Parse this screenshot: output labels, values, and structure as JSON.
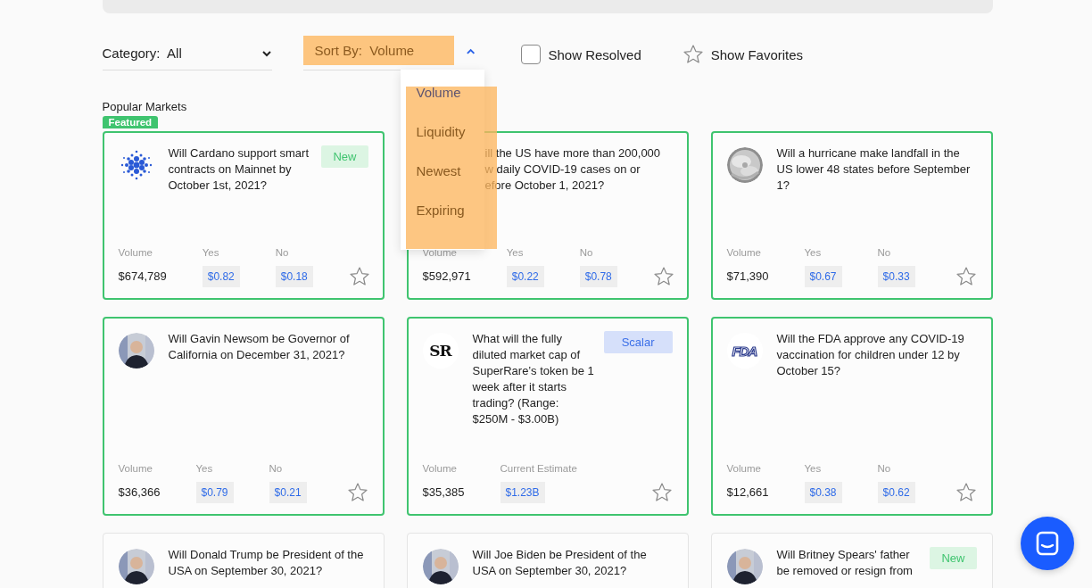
{
  "filters": {
    "category": {
      "label": "Category:",
      "value": "All"
    },
    "sort": {
      "label": "Sort By:",
      "value": "Volume",
      "expanded": true,
      "options": [
        {
          "label": "Volume",
          "selected": true
        },
        {
          "label": "Liquidity",
          "selected": false
        },
        {
          "label": "Newest",
          "selected": false
        },
        {
          "label": "Expiring",
          "selected": false
        }
      ]
    },
    "show_resolved": {
      "label": "Show Resolved",
      "checked": false
    },
    "show_favorites": {
      "label": "Show Favorites"
    }
  },
  "section_title": "Popular Markets",
  "markets": [
    {
      "highlighted": true,
      "tag": "Featured",
      "avatar": {
        "kind": "dots"
      },
      "question": "Will Cardano support smart contracts on Mainnet by October 1st, 2021?",
      "badge": {
        "kind": "new",
        "text": "New"
      },
      "stats": [
        {
          "kind": "plain",
          "label": "Volume",
          "value": "$674,789"
        },
        {
          "kind": "chip",
          "label": "Yes",
          "value": "$0.82"
        },
        {
          "kind": "chip",
          "label": "No",
          "value": "$0.18"
        }
      ],
      "favorite": false
    },
    {
      "highlighted": true,
      "avatar": {
        "kind": "hidden"
      },
      "question": "ill the US have more than 200,000\nw daily COVID-19 cases on or\nefore October 1, 2021?",
      "stats": [
        {
          "kind": "plain",
          "label": "Volume",
          "value": "$592,971"
        },
        {
          "kind": "chip",
          "label": "Yes",
          "value": "$0.22"
        },
        {
          "kind": "chip",
          "label": "No",
          "value": "$0.78"
        }
      ],
      "favorite": false
    },
    {
      "highlighted": true,
      "avatar": {
        "kind": "picture"
      },
      "question": "Will a hurricane make landfall in the US lower 48 states before September 1?",
      "stats": [
        {
          "kind": "plain",
          "label": "Volume",
          "value": "$71,390"
        },
        {
          "kind": "chip",
          "label": "Yes",
          "value": "$0.67"
        },
        {
          "kind": "chip",
          "label": "No",
          "value": "$0.33"
        }
      ],
      "favorite": false
    },
    {
      "highlighted": true,
      "avatar": {
        "kind": "person"
      },
      "question": "Will Gavin Newsom be Governor of California on December 31, 2021?",
      "stats": [
        {
          "kind": "plain",
          "label": "Volume",
          "value": "$36,366"
        },
        {
          "kind": "chip",
          "label": "Yes",
          "value": "$0.79"
        },
        {
          "kind": "chip",
          "label": "No",
          "value": "$0.21"
        }
      ],
      "favorite": false
    },
    {
      "highlighted": true,
      "avatar": {
        "kind": "serif-mark",
        "text": "SR"
      },
      "question": "What will the fully diluted market cap of SuperRare’s token be 1 week after it starts trading? (Range: $250M - $3.00B)",
      "badge": {
        "kind": "scalar",
        "text": "Scalar"
      },
      "stats": [
        {
          "kind": "plain",
          "label": "Volume",
          "value": "$35,385"
        },
        {
          "kind": "chip",
          "label": "Current Estimate",
          "value": "$1.23B"
        }
      ],
      "favorite": false
    },
    {
      "highlighted": true,
      "avatar": {
        "kind": "outline-mark",
        "text": "FDA"
      },
      "question": "Will the FDA approve any COVID-19 vaccination for children under 12 by October 15?",
      "stats": [
        {
          "kind": "plain",
          "label": "Volume",
          "value": "$12,661"
        },
        {
          "kind": "chip",
          "label": "Yes",
          "value": "$0.38"
        },
        {
          "kind": "chip",
          "label": "No",
          "value": "$0.62"
        }
      ],
      "favorite": false
    },
    {
      "highlighted": false,
      "avatar": {
        "kind": "person"
      },
      "question": "Will Donald Trump be President of the USA on September 30, 2021?"
    },
    {
      "highlighted": false,
      "avatar": {
        "kind": "person"
      },
      "question": "Will Joe Biden be President of the USA on September 30, 2021?"
    },
    {
      "highlighted": false,
      "avatar": {
        "kind": "person"
      },
      "question": "Will Britney Spears' father\nbe removed or resign from",
      "badge": {
        "kind": "new",
        "text": "New"
      }
    }
  ]
}
